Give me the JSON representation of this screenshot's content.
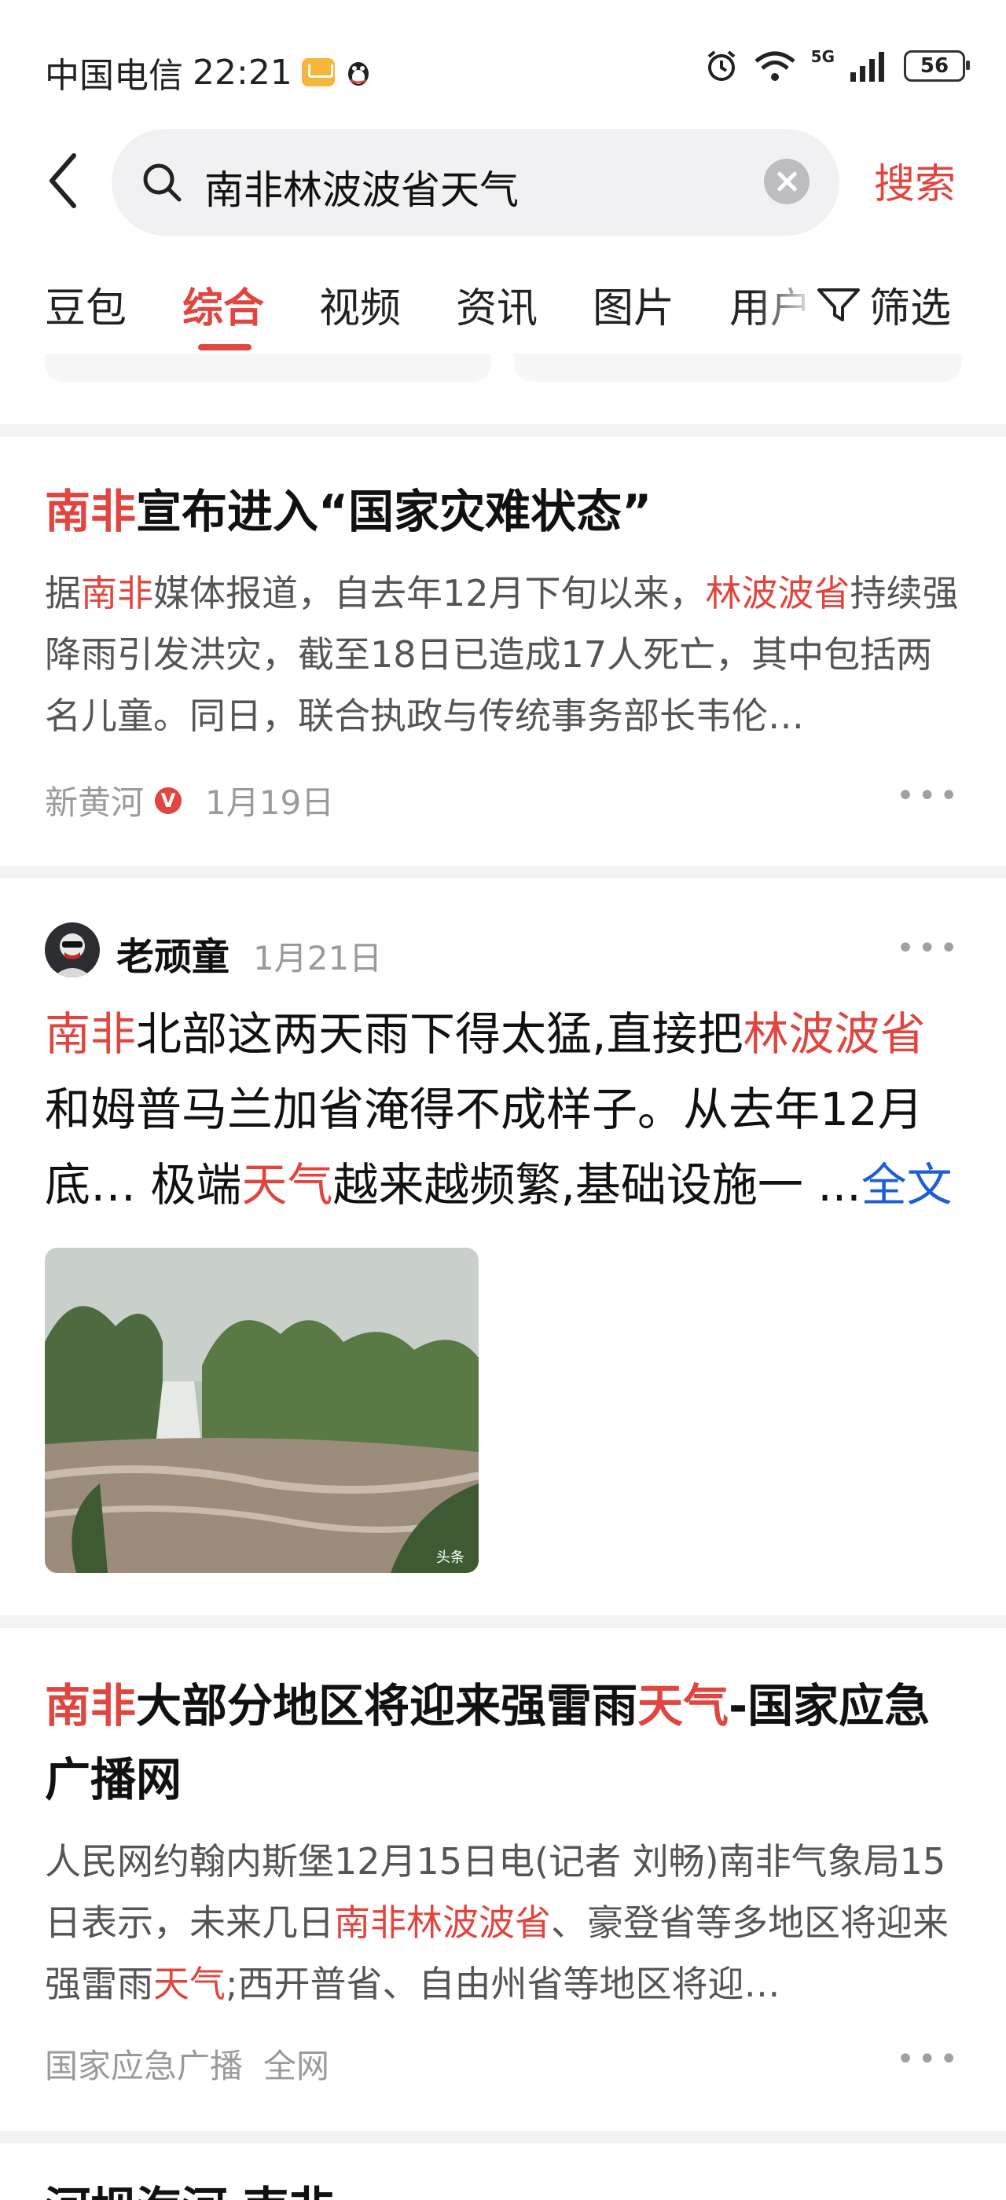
{
  "status_bar": {
    "carrier": "中国电信",
    "time": "22:21",
    "network": "5G",
    "battery": "56"
  },
  "search": {
    "query": "南非林波波省天气",
    "button": "搜索"
  },
  "tabs": [
    "豆包",
    "综合",
    "视频",
    "资讯",
    "图片",
    "用户"
  ],
  "active_tab": "综合",
  "filter_label": "筛选",
  "articles": [
    {
      "title_hl": "南非",
      "title_rest": "宣布进入“国家灾难状态”",
      "snippet": {
        "s1": "据",
        "h1": "南非",
        "s2": "媒体报道，自去年12月下旬以来，",
        "h2": "林波波省",
        "s3": "持续强降雨引发洪灾，截至18日已造成17人死亡，其中包括两名儿童。同日，联合执政与传统事务部长韦伦…"
      },
      "source": "新黄河",
      "verified_badge": "V",
      "date": "1月19日"
    },
    {
      "author": "老顽童",
      "date": "1月21日",
      "text": {
        "h1": "南非",
        "s1": "北部这两天雨下得太猛,直接把",
        "h2": "林波波省",
        "s2": "和姆普马兰加省淹得不成样子。从去年12月底… 极端",
        "h3": "天气",
        "s3": "越来越频繁,基础设施一 ...",
        "link": "全文"
      },
      "image_watermark": "头条"
    },
    {
      "title": {
        "h1": "南非",
        "s1": "大部分地区将迎来强雷雨",
        "h2": "天气",
        "s2": "-国家应急广播网"
      },
      "snippet": {
        "s1": "人民网约翰内斯堡12月15日电(记者 刘畅)南非气象局15日表示，未来几日",
        "h1": "南非林波波省",
        "s2": "、豪登省等多地区将迎来强雷雨",
        "h2": "天气",
        "s3": ";西开普省、自由州省等地区将迎…"
      },
      "source": "国家应急广播",
      "scope": "全网"
    },
    {
      "title_partial": "河坝海河 南非 ..."
    }
  ],
  "more_icon": "ellipsis-icon"
}
